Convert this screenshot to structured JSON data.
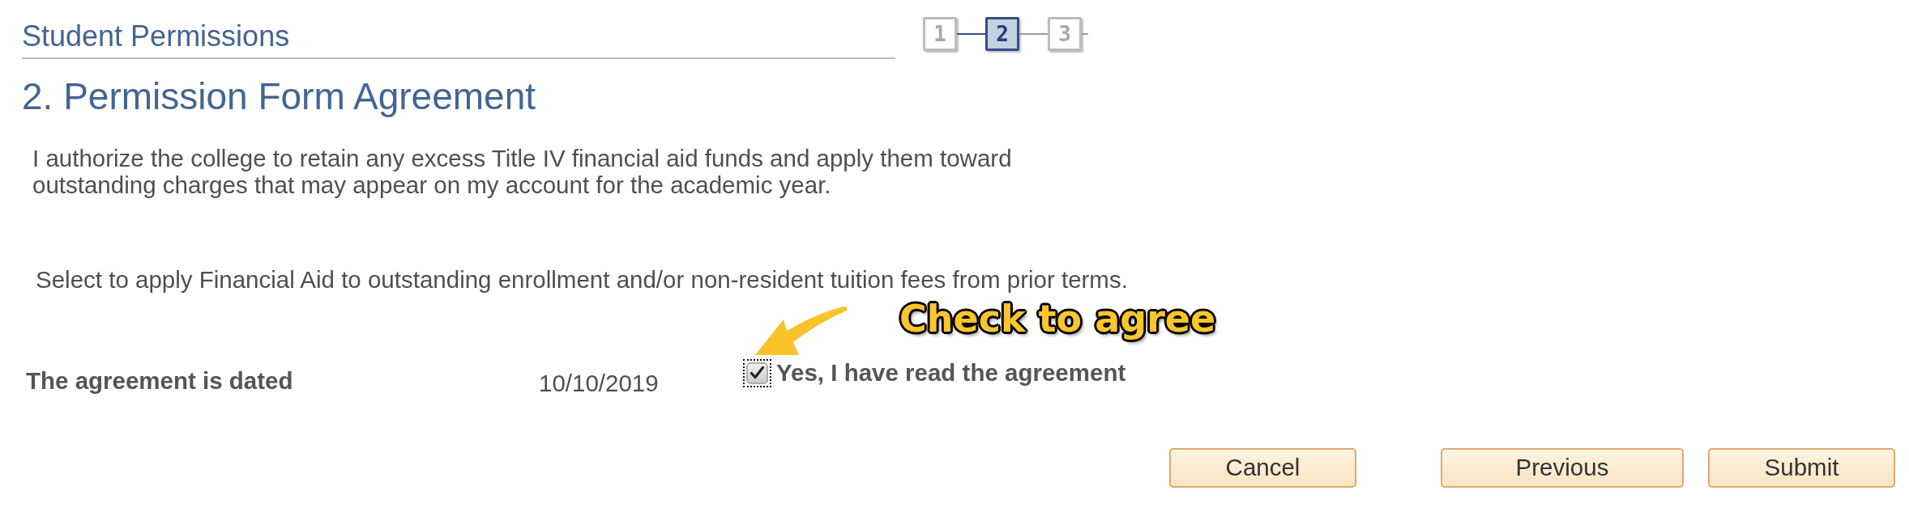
{
  "header": {
    "title": "Student Permissions",
    "steps": [
      {
        "label": "1",
        "selected": false
      },
      {
        "label": "2",
        "selected": true
      },
      {
        "label": "3",
        "selected": false
      }
    ]
  },
  "heading": "2. Permission Form Agreement",
  "agreement_text": "I authorize the college to retain any excess Title IV financial aid funds and apply them toward outstanding charges that may appear on my account for the academic year.",
  "instruction": "Select to apply Financial Aid to outstanding enrollment and/or non-resident tuition fees from prior terms.",
  "agreement_date": {
    "label": "The agreement is dated",
    "value": "10/10/2019"
  },
  "confirm": {
    "label": "Yes, I have read the agreement",
    "checked": true,
    "focused": true
  },
  "callout": {
    "text": "Check to agree"
  },
  "buttons": [
    {
      "label": "Cancel"
    },
    {
      "label": "Previous"
    },
    {
      "label": "Submit"
    }
  ]
}
